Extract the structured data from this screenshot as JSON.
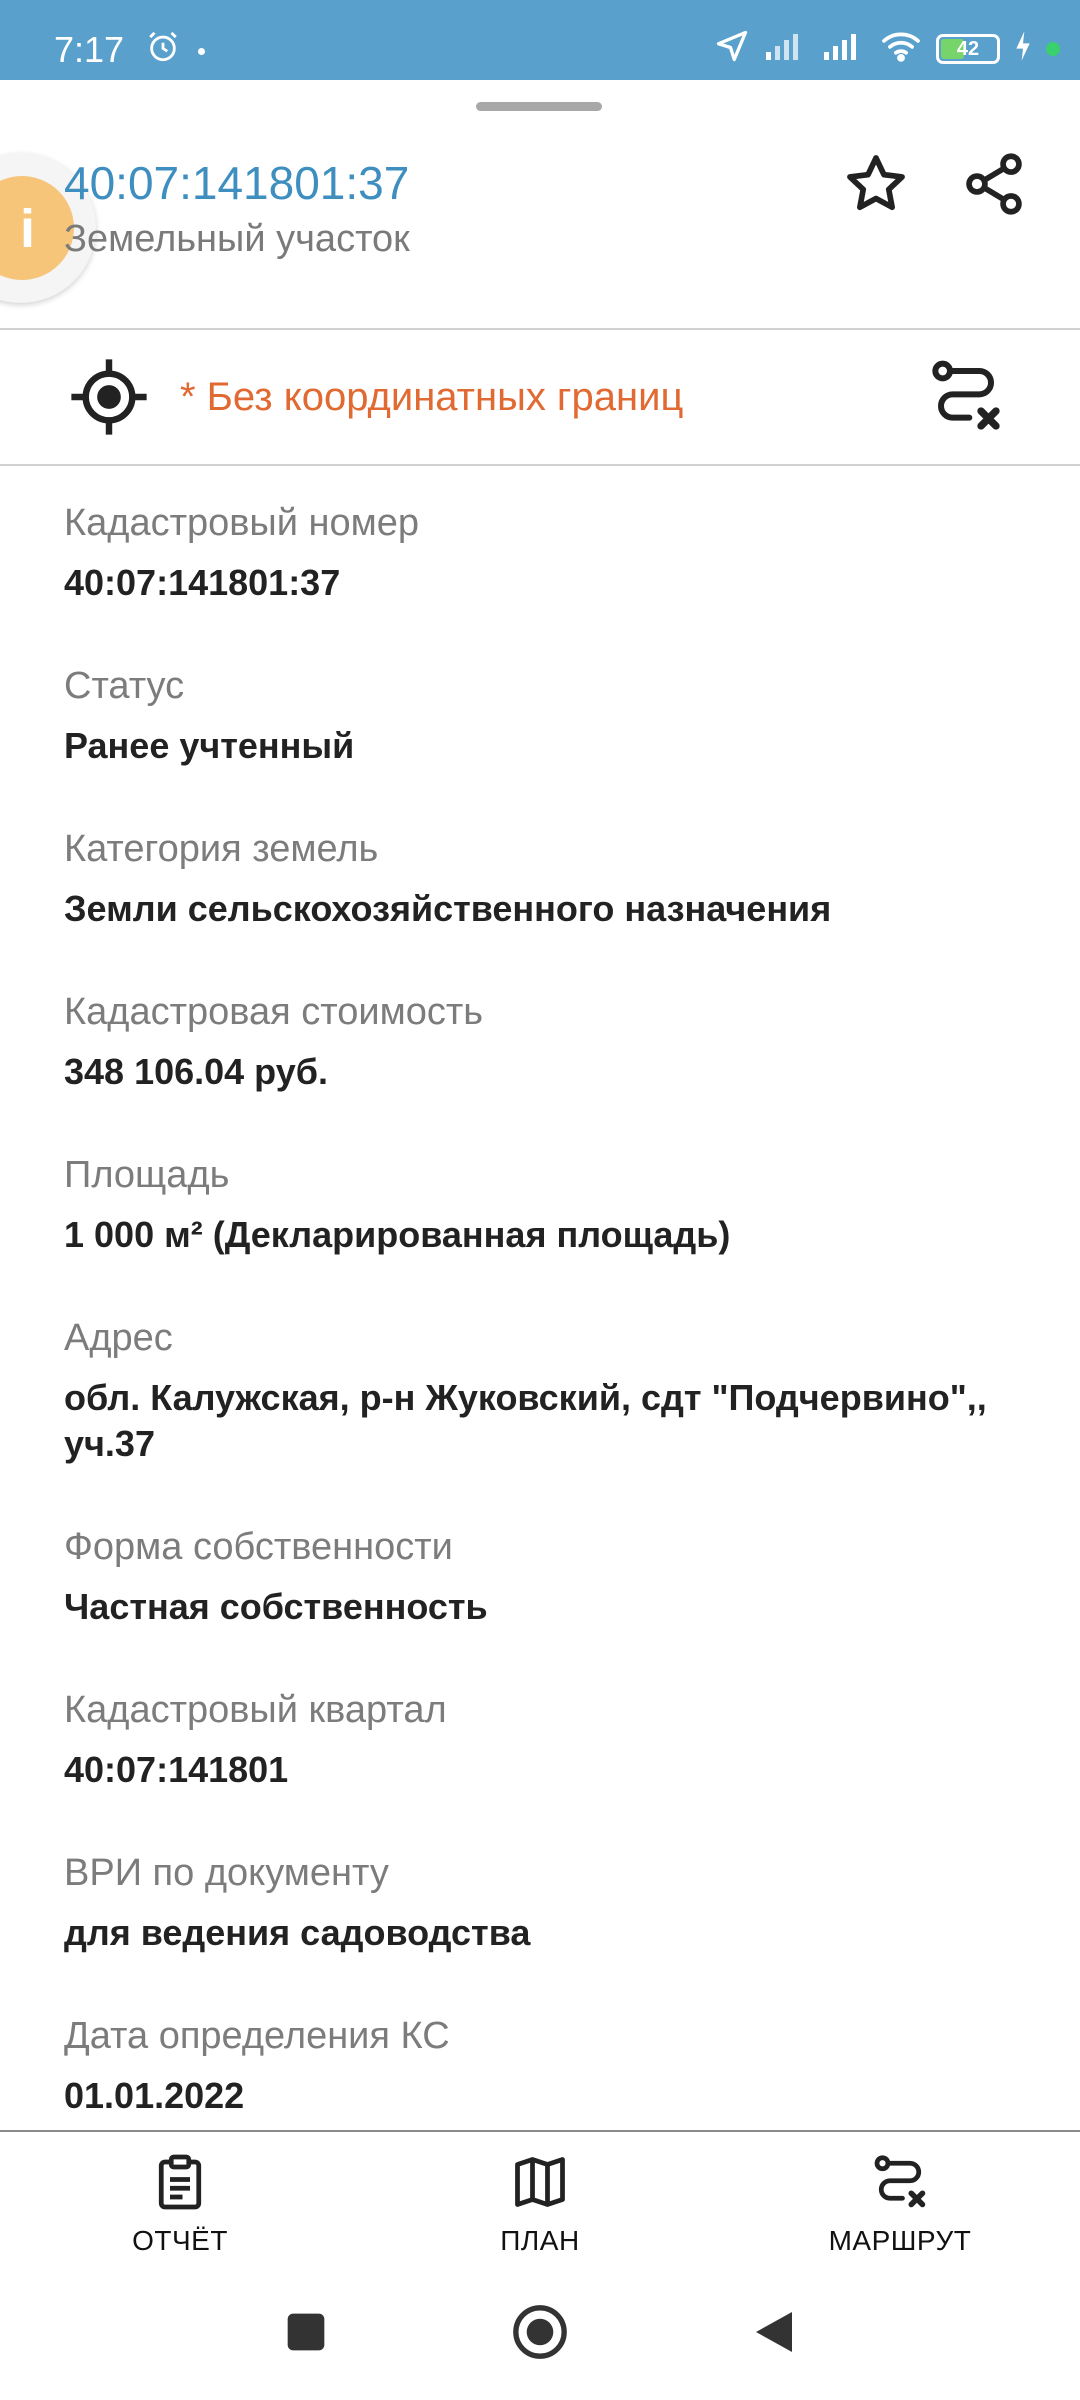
{
  "status_bar": {
    "time": "7:17",
    "battery": "42",
    "battery_level": 0.42,
    "colors": {
      "bar": "#5aa0cc",
      "battery_fill": "#76d46b",
      "charging_dot": "#3ad06d"
    }
  },
  "header": {
    "avatar_letter": "i",
    "cadastral_title": "40:07:141801:37",
    "object_type": "Земельный участок",
    "icons": [
      "star-icon",
      "share-icon"
    ]
  },
  "coordinates": {
    "text": "* Без координатных границ",
    "color": "#e06a32",
    "icons": [
      "crosshair-icon",
      "route-off-icon"
    ]
  },
  "properties": [
    {
      "label": "Кадастровый номер",
      "value": "40:07:141801:37"
    },
    {
      "label": "Статус",
      "value": "Ранее учтенный"
    },
    {
      "label": "Категория земель",
      "value": "Земли сельскохозяйственного назначения"
    },
    {
      "label": "Кадастровая стоимость",
      "value": "348 106.04 руб."
    },
    {
      "label": "Площадь",
      "value": "1 000 м² (Декларированная площадь)"
    },
    {
      "label": "Адрес",
      "value": "обл. Калужская, р-н Жуковский, сдт \"Подчервино\",, уч.37"
    },
    {
      "label": "Форма собственности",
      "value": "Частная собственность"
    },
    {
      "label": "Кадастровый квартал",
      "value": "40:07:141801"
    },
    {
      "label": "ВРИ по документу",
      "value": "для ведения садоводства"
    },
    {
      "label": "Дата определения КС",
      "value": "01.01.2022"
    }
  ],
  "bottom_nav": {
    "report": "ОТЧЁТ",
    "plan": "ПЛАН",
    "route": "МАРШРУТ"
  },
  "accent_color": "#3e8ec0"
}
